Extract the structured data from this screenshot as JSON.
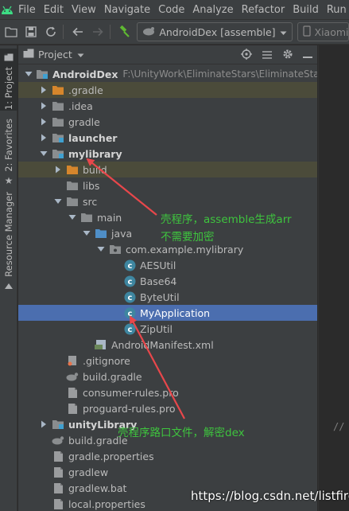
{
  "menu": [
    "File",
    "Edit",
    "View",
    "Navigate",
    "Code",
    "Analyze",
    "Refactor",
    "Build",
    "Run"
  ],
  "toolbar": {
    "run_config": "AndroidDex [assemble]",
    "device": "Xiaomi"
  },
  "sidebar": {
    "project_tab": "1: Project",
    "favorites_tab": "2: Favorites",
    "resource_tab": "Resource Manager"
  },
  "panel": {
    "title": "Project"
  },
  "tree": [
    {
      "label": "AndroidDex",
      "path": "F:\\UnityWork\\EliminateStars\\EliminateStars\\Bo",
      "bold": true,
      "arrow": "down",
      "icon": "module-folder-icon"
    },
    {
      "label": ".gradle",
      "arrow": "right",
      "icon": "orange-folder-icon",
      "highlight": true
    },
    {
      "label": ".idea",
      "arrow": "right",
      "icon": "folder-icon"
    },
    {
      "label": "gradle",
      "arrow": "right",
      "icon": "folder-icon"
    },
    {
      "label": "launcher",
      "bold": true,
      "arrow": "right",
      "icon": "module-folder-icon"
    },
    {
      "label": "mylibrary",
      "bold": true,
      "arrow": "down",
      "icon": "module-folder-icon"
    },
    {
      "label": "build",
      "arrow": "right",
      "icon": "orange-folder-icon",
      "highlight": true
    },
    {
      "label": "libs",
      "arrow": "",
      "icon": "folder-icon"
    },
    {
      "label": "src",
      "arrow": "down",
      "icon": "folder-icon"
    },
    {
      "label": "main",
      "arrow": "down",
      "icon": "folder-icon"
    },
    {
      "label": "java",
      "arrow": "down",
      "icon": "blue-folder-icon"
    },
    {
      "label": "com.example.mylibrary",
      "arrow": "down",
      "icon": "package-icon"
    },
    {
      "label": "AESUtil",
      "arrow": "",
      "icon": "class-icon"
    },
    {
      "label": "Base64",
      "arrow": "",
      "icon": "class-icon"
    },
    {
      "label": "ByteUtil",
      "arrow": "",
      "icon": "class-icon"
    },
    {
      "label": "MyApplication",
      "arrow": "",
      "icon": "class-icon",
      "selected": true
    },
    {
      "label": "ZipUtil",
      "arrow": "",
      "icon": "class-icon"
    },
    {
      "label": "AndroidManifest.xml",
      "arrow": "",
      "icon": "manifest-icon"
    },
    {
      "label": ".gitignore",
      "arrow": "",
      "icon": "gitignore-icon"
    },
    {
      "label": "build.gradle",
      "arrow": "",
      "icon": "gradle-icon"
    },
    {
      "label": "consumer-rules.pro",
      "arrow": "",
      "icon": "file-icon"
    },
    {
      "label": "proguard-rules.pro",
      "arrow": "",
      "icon": "file-icon"
    },
    {
      "label": "unityLibrary",
      "bold": true,
      "arrow": "right",
      "icon": "module-folder-icon"
    },
    {
      "label": "build.gradle",
      "arrow": "",
      "icon": "gradle-icon"
    },
    {
      "label": "gradle.properties",
      "arrow": "",
      "icon": "file-icon"
    },
    {
      "label": "gradlew",
      "arrow": "",
      "icon": "file-icon"
    },
    {
      "label": "gradlew.bat",
      "arrow": "",
      "icon": "file-icon"
    },
    {
      "label": "local.properties",
      "arrow": "",
      "icon": "file-icon"
    }
  ],
  "annotations": {
    "note1_line1": "壳程序，assemble生成arr",
    "note1_line2": "不需要加密",
    "note2": "壳程序路口文件，解密dex",
    "watermark": "https://blog.csdn.net/listfire"
  },
  "editor": {
    "comment": "//"
  },
  "colors": {
    "annotation_text": "#3ec43e",
    "arrow": "#e8474b",
    "selection": "#4b6eaf"
  }
}
